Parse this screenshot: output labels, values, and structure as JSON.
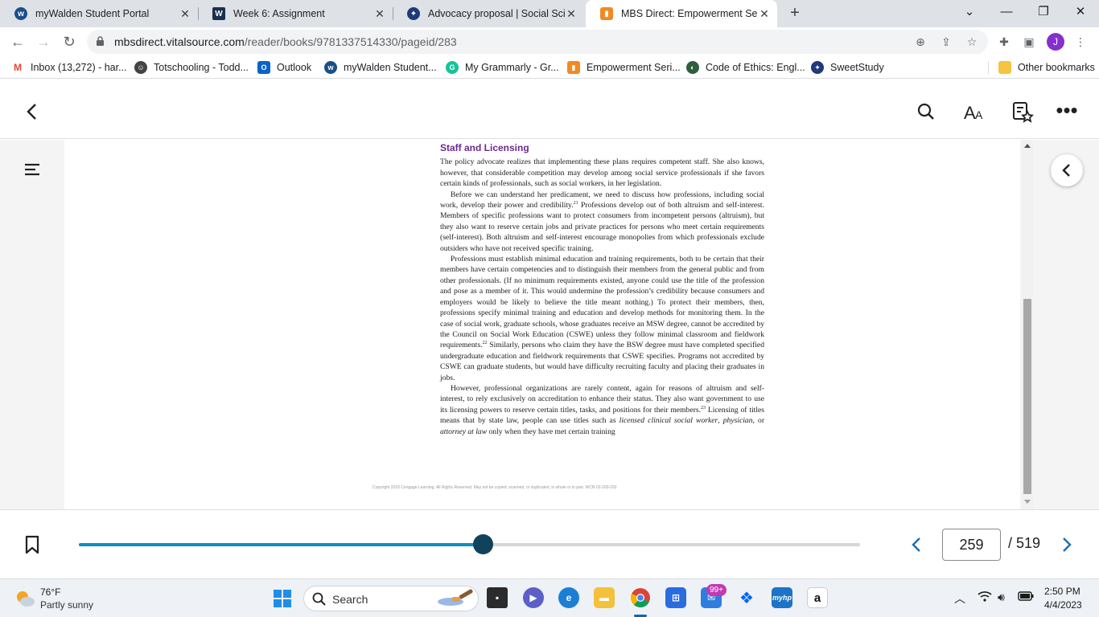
{
  "browser": {
    "tabs": [
      {
        "title": "myWalden Student Portal",
        "icon": "walden-w-icon",
        "active": false
      },
      {
        "title": "Week 6: Assignment",
        "icon": "walden-w-square-icon",
        "active": false
      },
      {
        "title": "Advocacy proposal | Social Scienc",
        "icon": "sweetstudy-icon",
        "active": false
      },
      {
        "title": "MBS Direct: Empowerment Series",
        "icon": "mbs-direct-icon",
        "active": true
      }
    ],
    "url_host": "mbsdirect.vitalsource.com",
    "url_path": "/reader/books/9781337514330/pageid/283",
    "profile_initial": "J",
    "bookmarks": [
      {
        "label": "Inbox (13,272) - har...",
        "icon": "gmail-icon"
      },
      {
        "label": "Totschooling - Todd...",
        "icon": "totschooling-icon"
      },
      {
        "label": "Outlook",
        "icon": "outlook-icon"
      },
      {
        "label": "myWalden Student...",
        "icon": "walden-w-icon"
      },
      {
        "label": "My Grammarly - Gr...",
        "icon": "grammarly-icon"
      },
      {
        "label": "Empowerment Seri...",
        "icon": "mbs-direct-icon"
      },
      {
        "label": "Code of Ethics: Engl...",
        "icon": "nasw-icon"
      },
      {
        "label": "SweetStudy",
        "icon": "sweetstudy-icon"
      }
    ],
    "other_bookmarks": "Other bookmarks"
  },
  "reader": {
    "section_heading": "Staff and Licensing",
    "paragraphs": [
      {
        "first": true,
        "segments": [
          {
            "t": "The policy advocate realizes that implementing these plans requires competent staff. She also knows, however, that considerable competition may develop among social service professionals if she favors certain kinds of professionals, such as social workers, in her legislation."
          }
        ]
      },
      {
        "first": false,
        "segments": [
          {
            "t": "Before we can understand her predicament, we need to discuss how professions, including social work, develop their power and credibility."
          },
          {
            "sup": "21"
          },
          {
            "t": " Professions develop out of both altruism and self-interest. Members of specific professions want to protect consumers from incompetent persons (altruism), but they also want to reserve certain jobs and private practices for persons who meet certain requirements (self-interest). Both altruism and self-interest encourage monopolies from which professionals exclude outsiders who have not received specific training."
          }
        ]
      },
      {
        "first": false,
        "segments": [
          {
            "t": "Professions must establish minimal education and training requirements, both to be certain that their members have certain competencies and to distinguish their members from the general public and from other professionals. (If no minimum requirements existed, anyone could use the title of the profession and pose as a member of it. This would undermine the profession’s credibility because consumers and employers would be likely to believe the title meant nothing.) To protect their members, then, professions specify minimal training and education and develop methods for monitoring them. In the case of social work, graduate schools, whose graduates receive an MSW degree, cannot be accredited by the Council on Social Work Education (CSWE) unless they follow minimal classroom and fieldwork requirements."
          },
          {
            "sup": "22"
          },
          {
            "t": " Similarly, persons who claim they have the BSW degree must have completed specified undergraduate education and fieldwork requirements that CSWE specifies. Programs not accredited by CSWE can graduate students, but would have difficulty recruiting faculty and placing their graduates in jobs."
          }
        ]
      },
      {
        "first": false,
        "segments": [
          {
            "t": "However, professional organizations are rarely content, again for reasons of altruism and self-interest, to rely exclusively on accreditation to enhance their status. They also want government to use its licensing powers to reserve certain titles, tasks, and positions for their members."
          },
          {
            "sup": "23"
          },
          {
            "t": " Licensing of titles means that by state law, people can use titles such as "
          },
          {
            "i": "licensed clinical social worker"
          },
          {
            "t": ", "
          },
          {
            "i": "physician"
          },
          {
            "t": ", or "
          },
          {
            "i": "attorney at law"
          },
          {
            "t": " only when they have met certain training"
          }
        ]
      }
    ],
    "copyright": "Copyright 2018 Cengage Learning. All Rights Reserved. May not be copied, scanned, or duplicated, in whole or in part.  WCN 02-200-202",
    "current_page": "259",
    "total_pages": "/ 519",
    "progress_fraction": 0.518
  },
  "taskbar": {
    "temperature": "76°F",
    "weather": "Partly sunny",
    "search_label": "Search",
    "mail_badge": "99+",
    "time": "2:50 PM",
    "date": "4/4/2023"
  },
  "colors": {
    "heading_purple": "#6b2a8c",
    "progress_blue": "#0b8fc2",
    "knob_navy": "#11425c",
    "pager_blue": "#1a6fb5"
  }
}
